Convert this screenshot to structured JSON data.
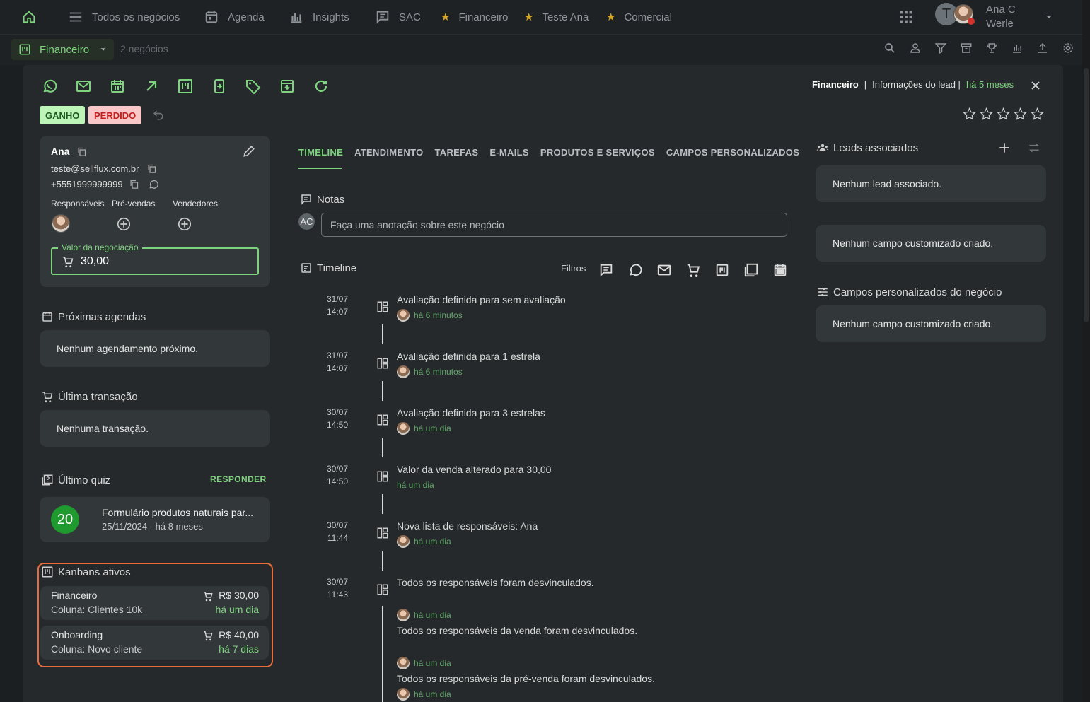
{
  "topbar": {
    "nav": [
      "Todos os negócios",
      "Agenda",
      "Insights",
      "SAC"
    ],
    "favorites": [
      "Financeiro",
      "Teste Ana",
      "Comercial"
    ],
    "user_initial": "T",
    "user_name_line1": "Ana C",
    "user_name_line2": "Werle"
  },
  "subbar": {
    "pipeline": "Financeiro",
    "count": "2 negócios"
  },
  "modal": {
    "header": {
      "pipeline": "Financeiro",
      "separator": "|",
      "info": "Informações do lead |",
      "time": "há 5 meses"
    },
    "badges": {
      "won": "GANHO",
      "lost": "PERDIDO"
    },
    "rating": {
      "value": 0,
      "max": 5
    },
    "contact": {
      "name": "Ana",
      "email": "teste@sellflux.com.br",
      "phone": "+5551999999999",
      "roles": [
        "Responsáveis",
        "Pré-vendas",
        "Vendedores"
      ],
      "value_label": "Valor da negociação",
      "value": "30,00"
    },
    "next_schedules": {
      "title": "Próximas agendas",
      "empty": "Nenhum agendamento próximo."
    },
    "last_transaction": {
      "title": "Última transação",
      "empty": "Nenhuma transação."
    },
    "last_quiz": {
      "title": "Último quiz",
      "action": "RESPONDER",
      "score": "20",
      "name": "Formulário produtos naturais par...",
      "date": "25/11/2024 - há 8 meses"
    },
    "kanbans": {
      "title": "Kanbans ativos",
      "items": [
        {
          "name": "Financeiro",
          "column": "Coluna: Clientes 10k",
          "value": "R$ 30,00",
          "time": "há um dia"
        },
        {
          "name": "Onboarding",
          "column": "Coluna: Novo cliente",
          "value": "R$ 40,00",
          "time": "há 7 dias"
        }
      ]
    },
    "tabs": [
      "TIMELINE",
      "ATENDIMENTO",
      "TAREFAS",
      "E-MAILS",
      "PRODUTOS E SERVIÇOS",
      "CAMPOS PERSONALIZADOS"
    ],
    "notes": {
      "title": "Notas",
      "avatar": "AC",
      "placeholder": "Faça uma anotação sobre este negócio"
    },
    "timeline": {
      "title": "Timeline",
      "filters_label": "Filtros",
      "events": [
        {
          "date": "31/07",
          "time": "14:07",
          "text": "Avaliação definida para sem avaliação",
          "ago": "há 6 minutos"
        },
        {
          "date": "31/07",
          "time": "14:07",
          "text": "Avaliação definida para 1 estrela",
          "ago": "há 6 minutos"
        },
        {
          "date": "30/07",
          "time": "14:50",
          "text": "Avaliação definida para 3 estrelas",
          "ago": "há um dia"
        },
        {
          "date": "30/07",
          "time": "14:50",
          "text": "Valor da venda alterado para 30,00",
          "ago": "há um dia"
        },
        {
          "date": "30/07",
          "time": "11:44",
          "text": "Nova lista de responsáveis: Ana",
          "ago": "há um dia"
        },
        {
          "date": "30/07",
          "time": "11:43",
          "text": "Todos os responsáveis foram desvinculados.",
          "ago": "há um dia",
          "extra1": "Todos os responsáveis da venda foram desvinculados.",
          "ago2": "há um dia",
          "extra2": "Todos os responsáveis da pré-venda foram desvinculados.",
          "ago3": "há um dia"
        }
      ]
    },
    "right": {
      "leads_title": "Leads associados",
      "leads_empty": "Nenhum lead associado.",
      "custom_empty": "Nenhum campo customizado criado.",
      "deal_fields_title": "Campos personalizados do negócio",
      "deal_fields_empty": "Nenhum campo customizado criado."
    }
  }
}
